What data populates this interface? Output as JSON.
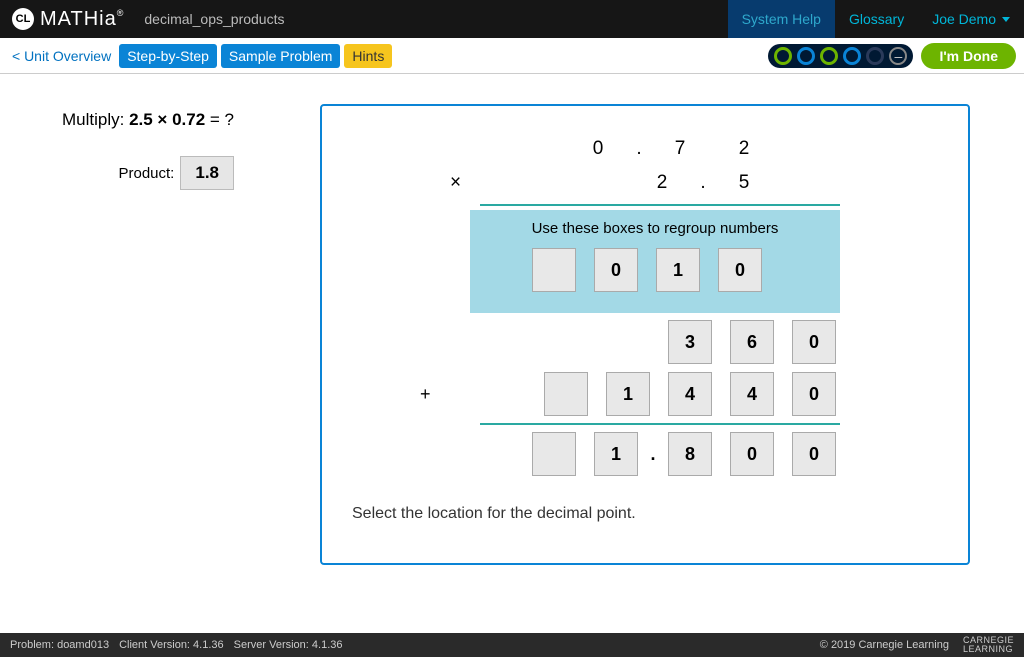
{
  "header": {
    "logo_badge": "CL",
    "logo_text": "MATHia",
    "module": "decimal_ops_products",
    "links": {
      "system": "System Help",
      "glossary": "Glossary"
    },
    "user": "Joe Demo"
  },
  "toolbar": {
    "overview": "< Unit Overview",
    "step": "Step-by-Step",
    "sample": "Sample Problem",
    "hints": "Hints",
    "done": "I'm Done"
  },
  "problem": {
    "prompt_prefix": "Multiply: ",
    "expression": "2.5 × 0.72",
    "prompt_suffix": " = ?",
    "product_label": "Product:",
    "product_value": "1.8"
  },
  "calc": {
    "top": {
      "d1": "0",
      "dot": ".",
      "d2": "7",
      "d3": "2"
    },
    "mult": {
      "op": "×",
      "d1": "2",
      "dot": ".",
      "d2": "5"
    },
    "regroup_title": "Use these boxes to regroup numbers",
    "regroup": {
      "b2": "0",
      "b3": "1",
      "b4": "0"
    },
    "row1": {
      "b3": "3",
      "b4": "6",
      "b5": "0"
    },
    "row2": {
      "op": "+",
      "b2": "1",
      "b3": "4",
      "b4": "4",
      "b5": "0"
    },
    "result": {
      "b2": "1",
      "dot": ".",
      "b3": "8",
      "b4": "0",
      "b5": "0"
    },
    "instruction": "Select the location for the decimal point."
  },
  "footer": {
    "problem": "Problem: doamd013",
    "client": "Client Version: 4.1.36",
    "server": "Server Version: 4.1.36",
    "copyright": "© 2019 Carnegie Learning",
    "brand1": "CARNEGIE",
    "brand2": "LEARNING"
  }
}
